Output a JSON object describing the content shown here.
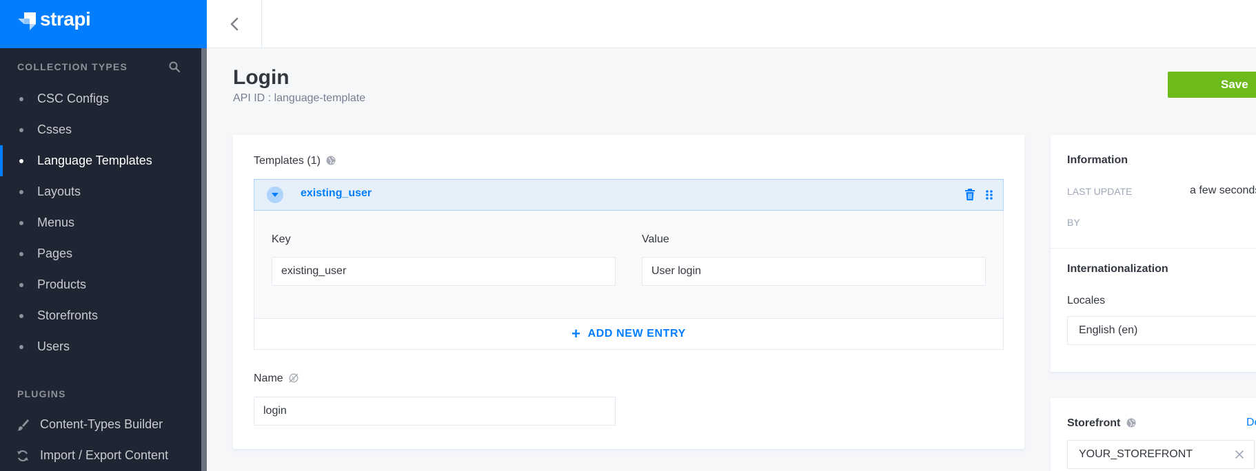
{
  "brand": {
    "name": "strapi",
    "color": "#007eff"
  },
  "sidebar": {
    "collection_types_title": "COLLECTION TYPES",
    "items": [
      {
        "label": "CSC Configs"
      },
      {
        "label": "Csses"
      },
      {
        "label": "Language Templates",
        "active": true
      },
      {
        "label": "Layouts"
      },
      {
        "label": "Menus"
      },
      {
        "label": "Pages"
      },
      {
        "label": "Products"
      },
      {
        "label": "Storefronts"
      },
      {
        "label": "Users"
      }
    ],
    "plugins_title": "PLUGINS",
    "plugins": [
      {
        "label": "Content-Types Builder",
        "icon": "brush-icon"
      },
      {
        "label": "Import / Export Content",
        "icon": "refresh-icon"
      }
    ]
  },
  "header": {
    "title": "Login",
    "api_id": "API ID : language-template",
    "save_label": "Save",
    "save_color": "#6dbb1a"
  },
  "templates": {
    "label": "Templates (1)",
    "entry_title": "existing_user",
    "key_label": "Key",
    "key_value": "existing_user",
    "value_label": "Value",
    "value_value": "User login",
    "add_entry_label": "ADD NEW ENTRY"
  },
  "name_field": {
    "label": "Name",
    "value": "login"
  },
  "information": {
    "title": "Information",
    "last_update_label": "LAST UPDATE",
    "last_update_value": "a few seconds ago",
    "by_label": "BY"
  },
  "internationalization": {
    "title": "Internationalization",
    "locales_label": "Locales",
    "locale_value": "English (en)"
  },
  "storefront": {
    "label": "Storefront",
    "link_text": "De",
    "value": "YOUR_STOREFRONT"
  }
}
